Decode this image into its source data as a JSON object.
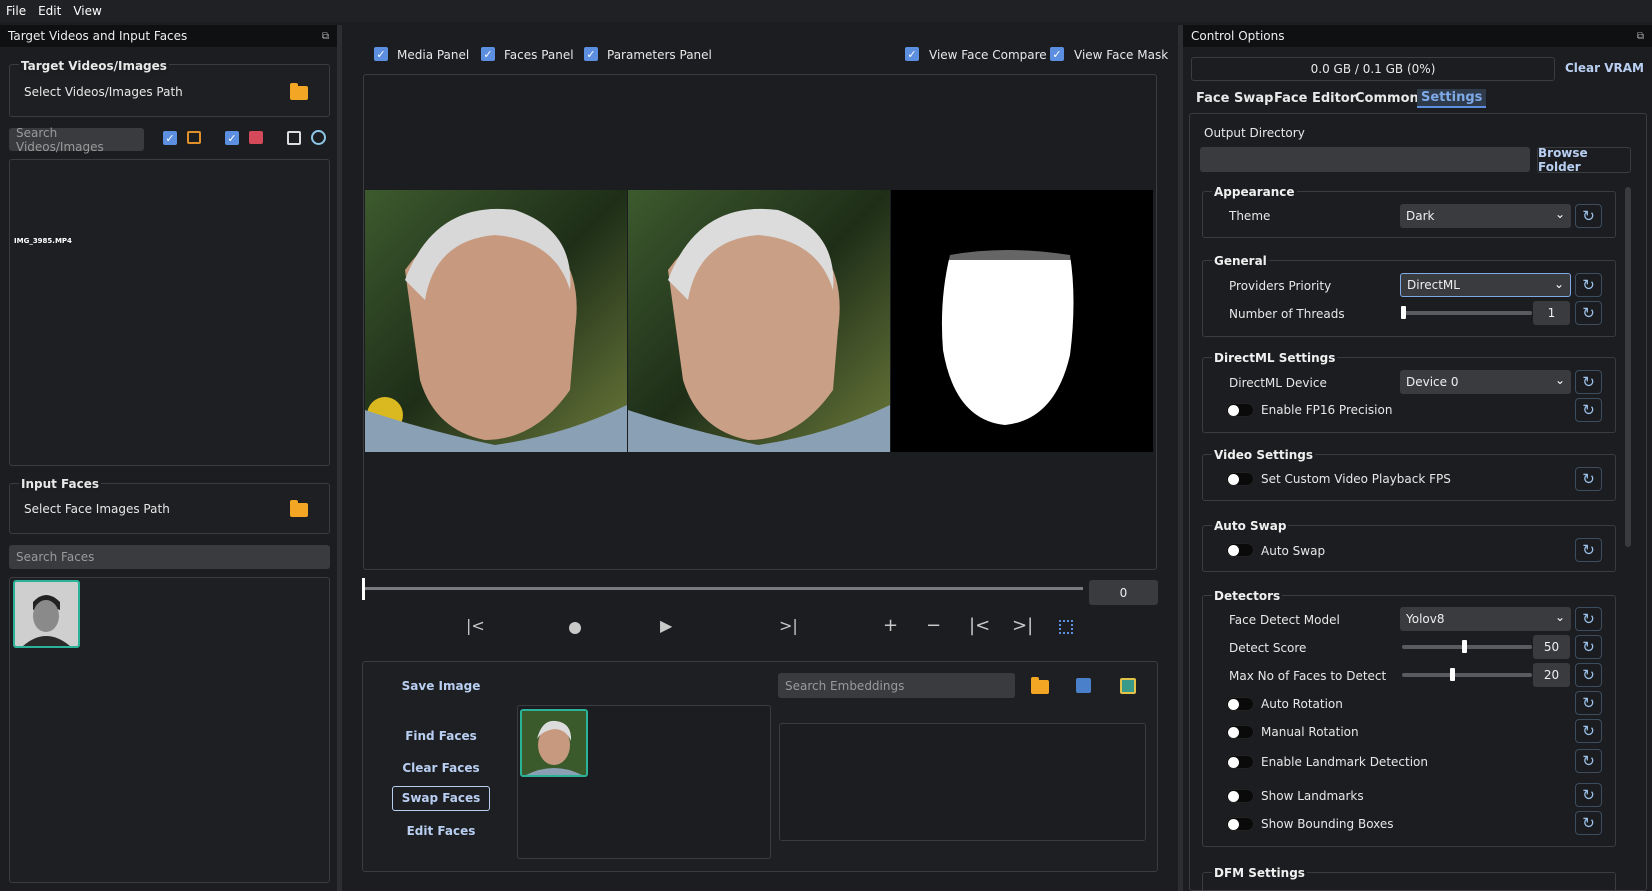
{
  "menu": [
    "File",
    "Edit",
    "View"
  ],
  "left": {
    "title": "Target Videos and Input Faces",
    "target_group": "Target Videos/Images",
    "select_videos": "Select Videos/Images Path",
    "search_videos": "Search Videos/Images",
    "file_item": "IMG_3985.MP4",
    "input_group": "Input Faces",
    "select_faces": "Select Face Images Path",
    "search_faces": "Search Faces"
  },
  "center": {
    "panels": [
      "Media Panel",
      "Faces Panel",
      "Parameters Panel"
    ],
    "view_compare": "View Face Compare",
    "view_mask": "View Face Mask",
    "frame_value": "0",
    "save_image": "Save Image",
    "find_faces": "Find Faces",
    "clear_faces": "Clear Faces",
    "swap_faces": "Swap Faces",
    "edit_faces": "Edit Faces",
    "search_embeddings": "Search Embeddings"
  },
  "right": {
    "title": "Control Options",
    "vram": "0.0 GB / 0.1 GB (0%)",
    "clear_vram": "Clear VRAM",
    "tabs": [
      "Face Swap",
      "Face Editor",
      "Common",
      "Settings"
    ],
    "output_dir_label": "Output Directory",
    "browse_folder": "Browse Folder",
    "appearance": {
      "title": "Appearance",
      "theme_label": "Theme",
      "theme_value": "Dark"
    },
    "general": {
      "title": "General",
      "providers_label": "Providers Priority",
      "providers_value": "DirectML",
      "threads_label": "Number of Threads",
      "threads_value": "1"
    },
    "directml": {
      "title": "DirectML Settings",
      "device_label": "DirectML Device",
      "device_value": "Device 0",
      "fp16_label": "Enable FP16 Precision"
    },
    "video": {
      "title": "Video Settings",
      "fps_label": "Set Custom Video Playback FPS"
    },
    "autoswap": {
      "title": "Auto Swap",
      "label": "Auto Swap"
    },
    "detectors": {
      "title": "Detectors",
      "model_label": "Face Detect Model",
      "model_value": "Yolov8",
      "score_label": "Detect Score",
      "score_value": "50",
      "max_label": "Max No of Faces to Detect",
      "max_value": "20",
      "auto_rot": "Auto Rotation",
      "manual_rot": "Manual Rotation",
      "landmark": "Enable Landmark Detection",
      "show_landmarks": "Show Landmarks",
      "show_boxes": "Show Bounding Boxes"
    },
    "dfm_title": "DFM Settings"
  },
  "colors": {
    "accent": "#5d8fe0",
    "link": "#b9cff2",
    "thumb_border": "#2bb39a",
    "folder": "#f2a623"
  }
}
